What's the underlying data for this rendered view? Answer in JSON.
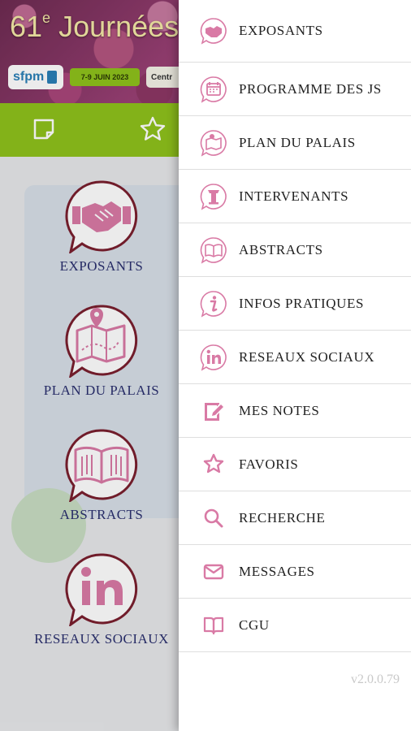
{
  "banner": {
    "title_number": "61",
    "title_sup": "e",
    "title_text": " Journées Sci",
    "logo": "sfpm",
    "dates": "7-9 JUIN 2023",
    "venue": "Centr"
  },
  "tabbar": {
    "icons": [
      "note-icon",
      "star-icon"
    ]
  },
  "home": {
    "items": [
      {
        "label": "EXPOSANTS",
        "icon": "handshake-icon"
      },
      {
        "label": "PLAN DU PALAIS",
        "icon": "map-icon"
      },
      {
        "label": "ABSTRACTS",
        "icon": "book-icon"
      },
      {
        "label": "RESEAUX SOCIAUX",
        "icon": "linkedin-icon"
      }
    ]
  },
  "drawer": {
    "items": [
      {
        "label": "EXPOSANTS",
        "icon": "handshake-icon"
      },
      {
        "label": "PROGRAMME DES JS",
        "icon": "calendar-icon"
      },
      {
        "label": "PLAN DU PALAIS",
        "icon": "map-icon"
      },
      {
        "label": "INTERVENANTS",
        "icon": "lectern-icon"
      },
      {
        "label": "ABSTRACTS",
        "icon": "book-icon"
      },
      {
        "label": "INFOS PRATIQUES",
        "icon": "info-icon"
      },
      {
        "label": "RESEAUX SOCIAUX",
        "icon": "linkedin-icon"
      },
      {
        "label": "MES NOTES",
        "icon": "edit-note-icon"
      },
      {
        "label": "FAVORIS",
        "icon": "star-icon"
      },
      {
        "label": "RECHERCHE",
        "icon": "search-icon"
      },
      {
        "label": "MESSAGES",
        "icon": "mail-icon"
      },
      {
        "label": "CGU",
        "icon": "open-book-icon"
      }
    ],
    "version": "v2.0.0.79"
  },
  "colors": {
    "accent_pink": "#d97aa5",
    "tabbar_green": "#8fc21c",
    "bubble_border": "#7a1f2e",
    "home_label": "#2a2f6e"
  }
}
